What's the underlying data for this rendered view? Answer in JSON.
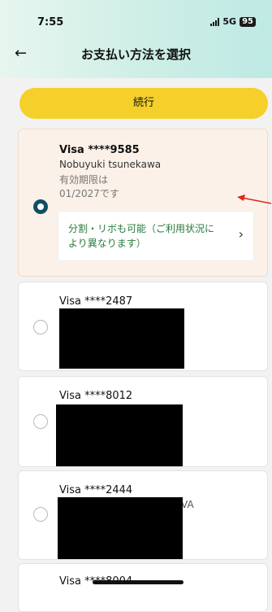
{
  "status": {
    "time": "7:55",
    "network": "5G",
    "battery": "95"
  },
  "header": {
    "title": "お支払い方法を選択",
    "back_icon": "←"
  },
  "continue_label": "続行",
  "cards": [
    {
      "brand": "Visa ****9585",
      "name": "Nobuyuki tsunekawa",
      "expiry_line1": "有効期限は",
      "expiry_line2": "01/2027です",
      "selected": true,
      "installment": "分割・リボも可能（ご利用状況により異なります）",
      "installment_chevron": "›"
    },
    {
      "brand": "Visa ****2487",
      "selected": false
    },
    {
      "brand": "Visa ****8012",
      "selected": false
    },
    {
      "brand": "Visa ****2444",
      "name_fragment": "VA",
      "selected": false
    },
    {
      "brand": "Visa ****8004",
      "selected": false
    }
  ],
  "colors": {
    "accent_yellow": "#f5d02a",
    "selected_bg": "#fbf1e8",
    "radio_selected": "#0e4f64",
    "installment_text": "#2a7a3a",
    "annotation_arrow": "#e0241b"
  }
}
